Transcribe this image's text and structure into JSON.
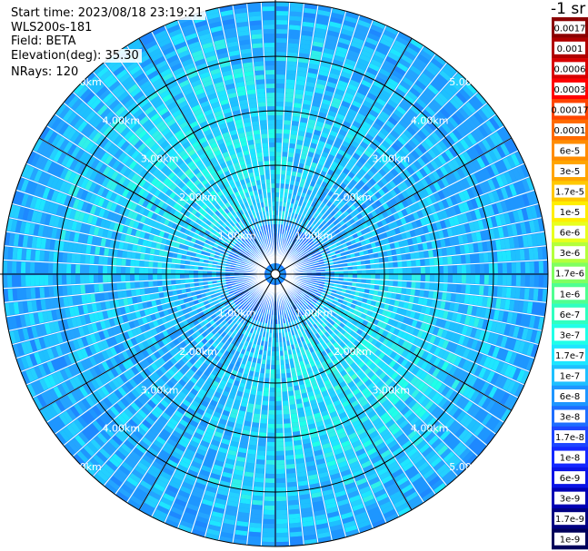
{
  "header": {
    "start_time": "Start time: 2023/08/18 23:19:21",
    "instrument": "WLS200s-181",
    "field": "Field: BETA",
    "elevation": "Elevation(deg): 35.30",
    "nrays": "NRays: 120"
  },
  "chart_data": {
    "type": "heatmap",
    "projection": "polar-ppi",
    "max_range_km": 5.0,
    "range_rings_km": [
      1.0,
      2.0,
      3.0,
      4.0,
      5.0
    ],
    "ring_labels": [
      "1.00km",
      "2.00km",
      "3.00km",
      "4.00km",
      "5.00km"
    ],
    "n_rays": 120,
    "spoke_angles_deg": [
      0,
      30,
      60,
      90,
      120,
      150,
      180,
      210,
      240,
      270,
      300,
      330
    ],
    "colorbar": {
      "unit_label": "-1 sr",
      "tick_labels": [
        "0.0017",
        "0.001",
        "0.0006",
        "0.0003",
        "0.00017",
        "0.0001",
        "6e-5",
        "3e-5",
        "1.7e-5",
        "1e-5",
        "6e-6",
        "3e-6",
        "1.7e-6",
        "1e-6",
        "6e-7",
        "3e-7",
        "1.7e-7",
        "1e-7",
        "6e-8",
        "3e-8",
        "1.7e-8",
        "1e-8",
        "6e-9",
        "3e-9",
        "1.7e-9",
        "1e-9"
      ],
      "colors": [
        "#8b0000",
        "#b00000",
        "#d80000",
        "#ff0000",
        "#ff4500",
        "#ff6a00",
        "#ff8c00",
        "#ffa500",
        "#ffc800",
        "#ffee00",
        "#e8ff1e",
        "#b4ff3c",
        "#80ff60",
        "#50ff90",
        "#30ffc0",
        "#20ffe8",
        "#1ee6ff",
        "#1ec0ff",
        "#1e96ff",
        "#1e6eff",
        "#1e46ff",
        "#1428ff",
        "#0a14e6",
        "#0000b4",
        "#000082",
        "#00005a"
      ]
    },
    "palette_blue_green": [
      "#1e6eff",
      "#1e88ff",
      "#1e96ff",
      "#24a4ff",
      "#1ec0ff",
      "#24d0ff",
      "#1ee6ff",
      "#30f0e8",
      "#20ffe8",
      "#40ffd0"
    ]
  }
}
